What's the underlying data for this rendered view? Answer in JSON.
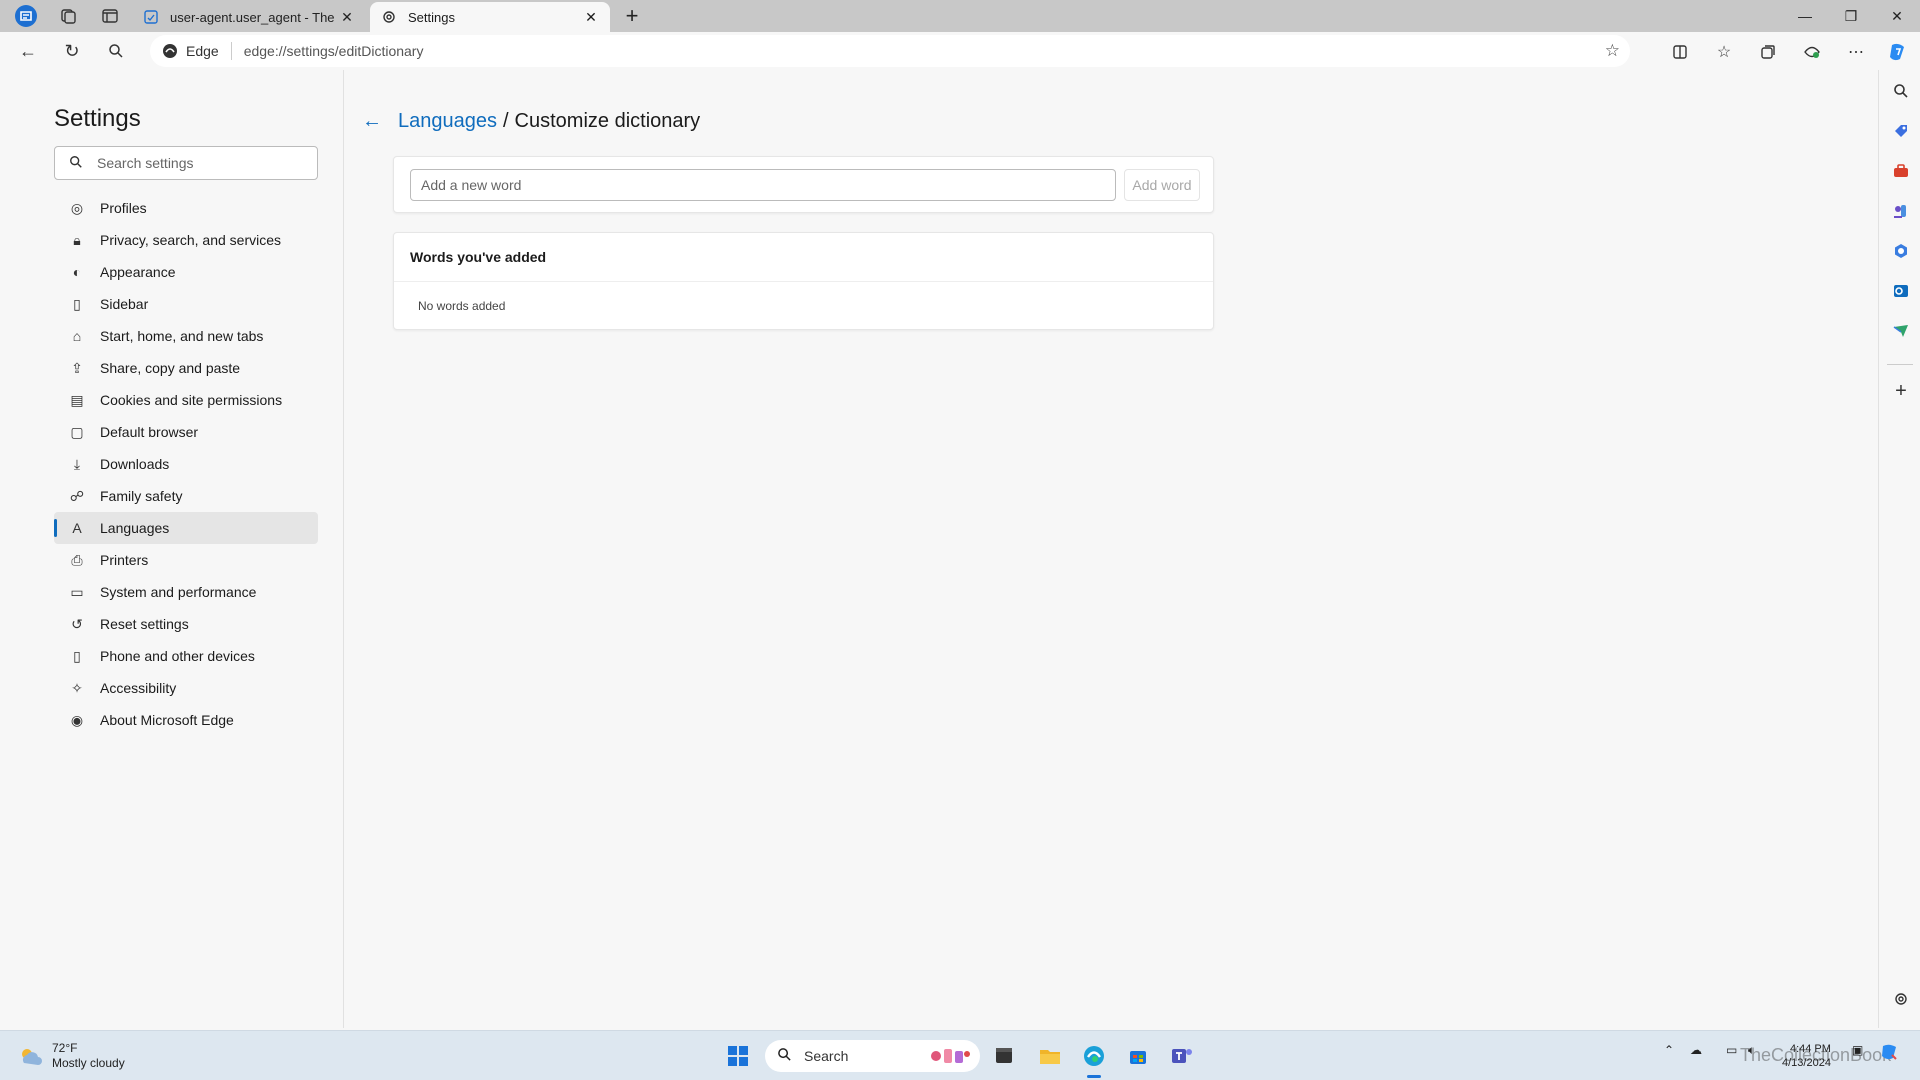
{
  "tabs": [
    {
      "title": "user-agent.user_agent - The Coll",
      "icon": "document-icon"
    },
    {
      "title": "Settings",
      "icon": "gear-icon"
    }
  ],
  "address": {
    "browser_label": "Edge",
    "url": "edge://settings/editDictionary"
  },
  "sidebar": {
    "title": "Settings",
    "search_placeholder": "Search settings",
    "items": [
      {
        "label": "Profiles",
        "icon": "profile-icon"
      },
      {
        "label": "Privacy, search, and services",
        "icon": "lock-icon"
      },
      {
        "label": "Appearance",
        "icon": "appearance-icon"
      },
      {
        "label": "Sidebar",
        "icon": "sidebar-icon"
      },
      {
        "label": "Start, home, and new tabs",
        "icon": "home-icon"
      },
      {
        "label": "Share, copy and paste",
        "icon": "share-icon"
      },
      {
        "label": "Cookies and site permissions",
        "icon": "cookie-icon"
      },
      {
        "label": "Default browser",
        "icon": "browser-icon"
      },
      {
        "label": "Downloads",
        "icon": "download-icon"
      },
      {
        "label": "Family safety",
        "icon": "family-icon"
      },
      {
        "label": "Languages",
        "icon": "language-icon",
        "selected": true
      },
      {
        "label": "Printers",
        "icon": "printer-icon"
      },
      {
        "label": "System and performance",
        "icon": "system-icon"
      },
      {
        "label": "Reset settings",
        "icon": "reset-icon"
      },
      {
        "label": "Phone and other devices",
        "icon": "phone-icon"
      },
      {
        "label": "Accessibility",
        "icon": "accessibility-icon"
      },
      {
        "label": "About Microsoft Edge",
        "icon": "edge-icon"
      }
    ]
  },
  "main": {
    "breadcrumb_link": "Languages",
    "breadcrumb_separator": "/",
    "breadcrumb_current": "Customize dictionary",
    "input_placeholder": "Add a new word",
    "add_button": "Add word",
    "words_header": "Words you've added",
    "words_empty": "No words added"
  },
  "taskbar": {
    "temperature": "72°F",
    "weather_desc": "Mostly cloudy",
    "search_label": "Search",
    "time": "4:44 PM",
    "date": "4/13/2024",
    "watermark": "TheCollectionBook"
  },
  "colors": {
    "accent": "#0f6cbd",
    "taskbar": "#dde7f0",
    "titlebar": "#c8c8c8"
  }
}
